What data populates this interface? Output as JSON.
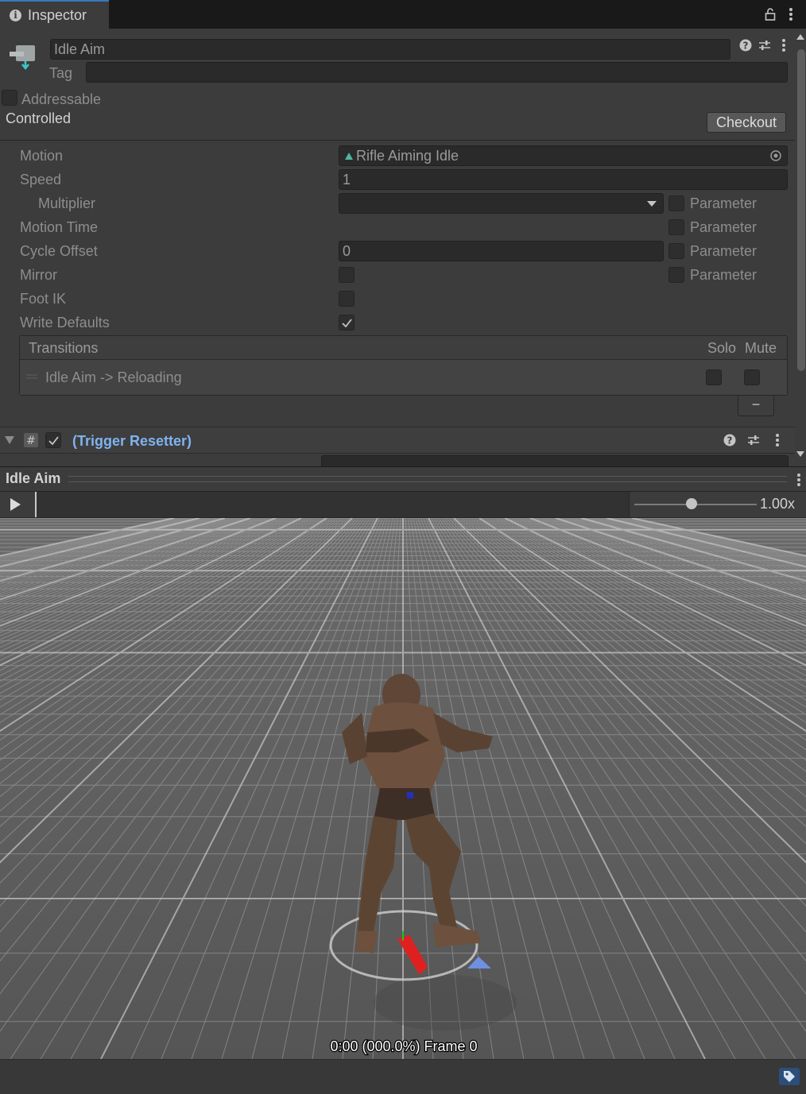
{
  "window": {
    "tab_label": "Inspector"
  },
  "inspector": {
    "state_name": "Idle Aim",
    "tag_label": "Tag",
    "tag_value": "",
    "addressable_label": "Addressable",
    "controlled_label": "Controlled",
    "checkout_label": "Checkout",
    "fields": {
      "motion_label": "Motion",
      "motion_value": "Rifle Aiming Idle",
      "speed_label": "Speed",
      "speed_value": "1",
      "multiplier_label": "Multiplier",
      "motion_time_label": "Motion Time",
      "cycle_offset_label": "Cycle Offset",
      "cycle_offset_value": "0",
      "mirror_label": "Mirror",
      "foot_ik_label": "Foot IK",
      "write_defaults_label": "Write Defaults",
      "parameter_label": "Parameter"
    },
    "transitions": {
      "header": "Transitions",
      "solo_label": "Solo",
      "mute_label": "Mute",
      "items": [
        {
          "label": "Idle Aim -> Reloading"
        }
      ],
      "remove_label": "−"
    },
    "component": {
      "name": "(Trigger Resetter)"
    }
  },
  "preview": {
    "title": "Idle Aim",
    "speed": "1.00x",
    "speed_fraction": 0.47,
    "time_readout": "0:00 (000.0%) Frame 0"
  }
}
